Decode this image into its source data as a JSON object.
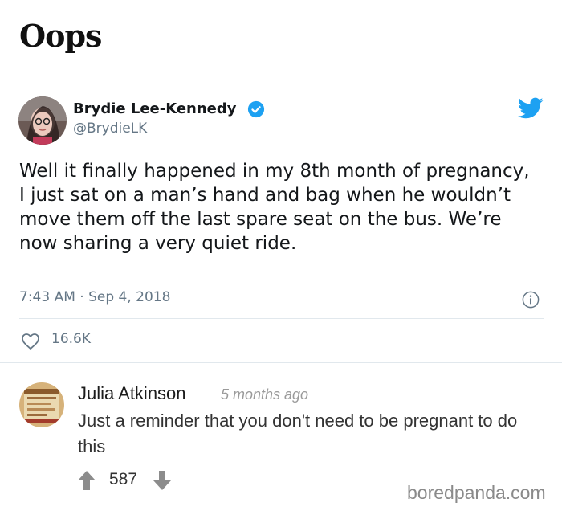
{
  "page": {
    "title": "Oops"
  },
  "tweet": {
    "author_name": "Brydie Lee-Kennedy",
    "handle": "@BrydieLK",
    "text": "Well it finally happened in my 8th month of pregnancy, I just sat on a man’s hand and bag when he wouldn’t move them off the last spare seat on the bus. We’re now sharing a very quiet ride.",
    "timestamp": "7:43 AM · Sep 4, 2018",
    "likes": "16.6K",
    "colors": {
      "twitter_blue": "#1da1f2",
      "muted": "#657786"
    }
  },
  "comment": {
    "author": "Julia Atkinson",
    "time": "5 months ago",
    "text": "Just a reminder that you don't need to be pregnant to do this",
    "score": "587"
  },
  "watermark": "boredpanda.com"
}
